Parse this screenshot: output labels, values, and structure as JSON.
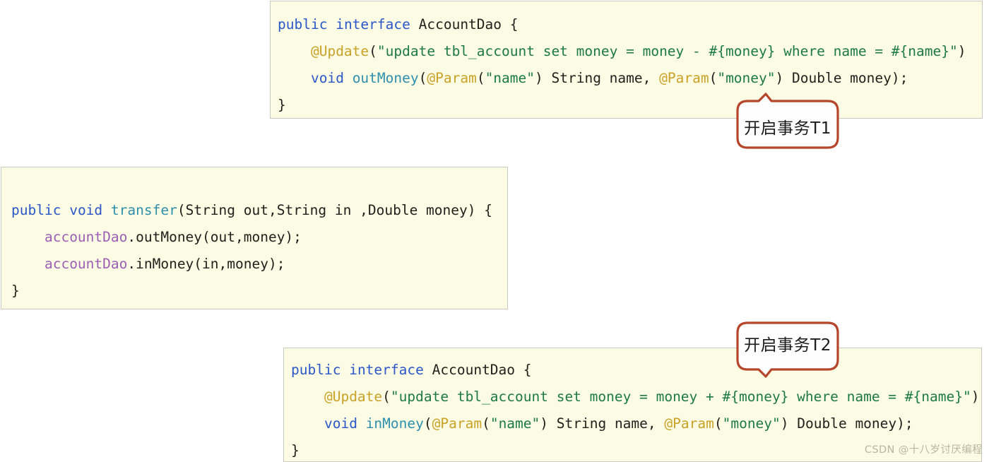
{
  "colors": {
    "code_background": "#fcfbe3",
    "code_border": "#c9c9c2",
    "keyword": "#2b57c9",
    "annotation": "#c9a227",
    "string": "#1d7a46",
    "method": "#2e8fae",
    "field": "#9c5fb5",
    "plain_text": "#23201d",
    "callout_stroke": "#b5452b",
    "callout_fill": "#fefefe",
    "watermark": "#b9b6a4",
    "page_background": "#ffffff"
  },
  "code_blocks": [
    {
      "id": "account-dao-out",
      "name": "AccountDao outMoney interface",
      "lines": [
        [
          {
            "t": "public",
            "c": "kw"
          },
          {
            "t": " ",
            "c": "plain"
          },
          {
            "t": "interface",
            "c": "kw"
          },
          {
            "t": " AccountDao {",
            "c": "plain"
          }
        ],
        [
          {
            "t": "    ",
            "c": "plain"
          },
          {
            "t": "@Update",
            "c": "anno"
          },
          {
            "t": "(",
            "c": "plain"
          },
          {
            "t": "\"update tbl_account set money = money - #{money} where name = #{name}\"",
            "c": "str"
          },
          {
            "t": ")",
            "c": "plain"
          }
        ],
        [
          {
            "t": "    ",
            "c": "plain"
          },
          {
            "t": "void",
            "c": "kw"
          },
          {
            "t": " ",
            "c": "plain"
          },
          {
            "t": "outMoney",
            "c": "method"
          },
          {
            "t": "(",
            "c": "plain"
          },
          {
            "t": "@Param",
            "c": "anno"
          },
          {
            "t": "(",
            "c": "plain"
          },
          {
            "t": "\"name\"",
            "c": "str"
          },
          {
            "t": ") String name, ",
            "c": "plain"
          },
          {
            "t": "@Param",
            "c": "anno"
          },
          {
            "t": "(",
            "c": "plain"
          },
          {
            "t": "\"money\"",
            "c": "str"
          },
          {
            "t": ") Double money);",
            "c": "plain"
          }
        ],
        [
          {
            "t": "}",
            "c": "plain"
          }
        ]
      ]
    },
    {
      "id": "transfer",
      "name": "transfer service method",
      "lines": [
        [
          {
            "t": "public",
            "c": "kw"
          },
          {
            "t": " ",
            "c": "plain"
          },
          {
            "t": "void",
            "c": "kw"
          },
          {
            "t": " ",
            "c": "plain"
          },
          {
            "t": "transfer",
            "c": "method"
          },
          {
            "t": "(String out,String in ,Double money) {",
            "c": "plain"
          }
        ],
        [
          {
            "t": "    ",
            "c": "plain"
          },
          {
            "t": "accountDao",
            "c": "field"
          },
          {
            "t": ".outMoney(out,money);",
            "c": "plain"
          }
        ],
        [
          {
            "t": "    ",
            "c": "plain"
          },
          {
            "t": "accountDao",
            "c": "field"
          },
          {
            "t": ".inMoney(in,money);",
            "c": "plain"
          }
        ],
        [
          {
            "t": "}",
            "c": "plain"
          }
        ]
      ]
    },
    {
      "id": "account-dao-in",
      "name": "AccountDao inMoney interface",
      "lines": [
        [
          {
            "t": "public",
            "c": "kw"
          },
          {
            "t": " ",
            "c": "plain"
          },
          {
            "t": "interface",
            "c": "kw"
          },
          {
            "t": " AccountDao {",
            "c": "plain"
          }
        ],
        [
          {
            "t": "    ",
            "c": "plain"
          },
          {
            "t": "@Update",
            "c": "anno"
          },
          {
            "t": "(",
            "c": "plain"
          },
          {
            "t": "\"update tbl_account set money = money + #{money} where name = #{name}\"",
            "c": "str"
          },
          {
            "t": ")",
            "c": "plain"
          }
        ],
        [
          {
            "t": "    ",
            "c": "plain"
          },
          {
            "t": "void",
            "c": "kw"
          },
          {
            "t": " ",
            "c": "plain"
          },
          {
            "t": "inMoney",
            "c": "method"
          },
          {
            "t": "(",
            "c": "plain"
          },
          {
            "t": "@Param",
            "c": "anno"
          },
          {
            "t": "(",
            "c": "plain"
          },
          {
            "t": "\"name\"",
            "c": "str"
          },
          {
            "t": ") String name, ",
            "c": "plain"
          },
          {
            "t": "@Param",
            "c": "anno"
          },
          {
            "t": "(",
            "c": "plain"
          },
          {
            "t": "\"money\"",
            "c": "str"
          },
          {
            "t": ") Double money);",
            "c": "plain"
          }
        ],
        [
          {
            "t": "}",
            "c": "plain"
          }
        ]
      ]
    }
  ],
  "callouts": {
    "t1": {
      "label": "开启事务T1",
      "tail": "up"
    },
    "t2": {
      "label": "开启事务T2",
      "tail": "down"
    }
  },
  "watermark": {
    "text": "CSDN @十八岁讨厌编程"
  }
}
